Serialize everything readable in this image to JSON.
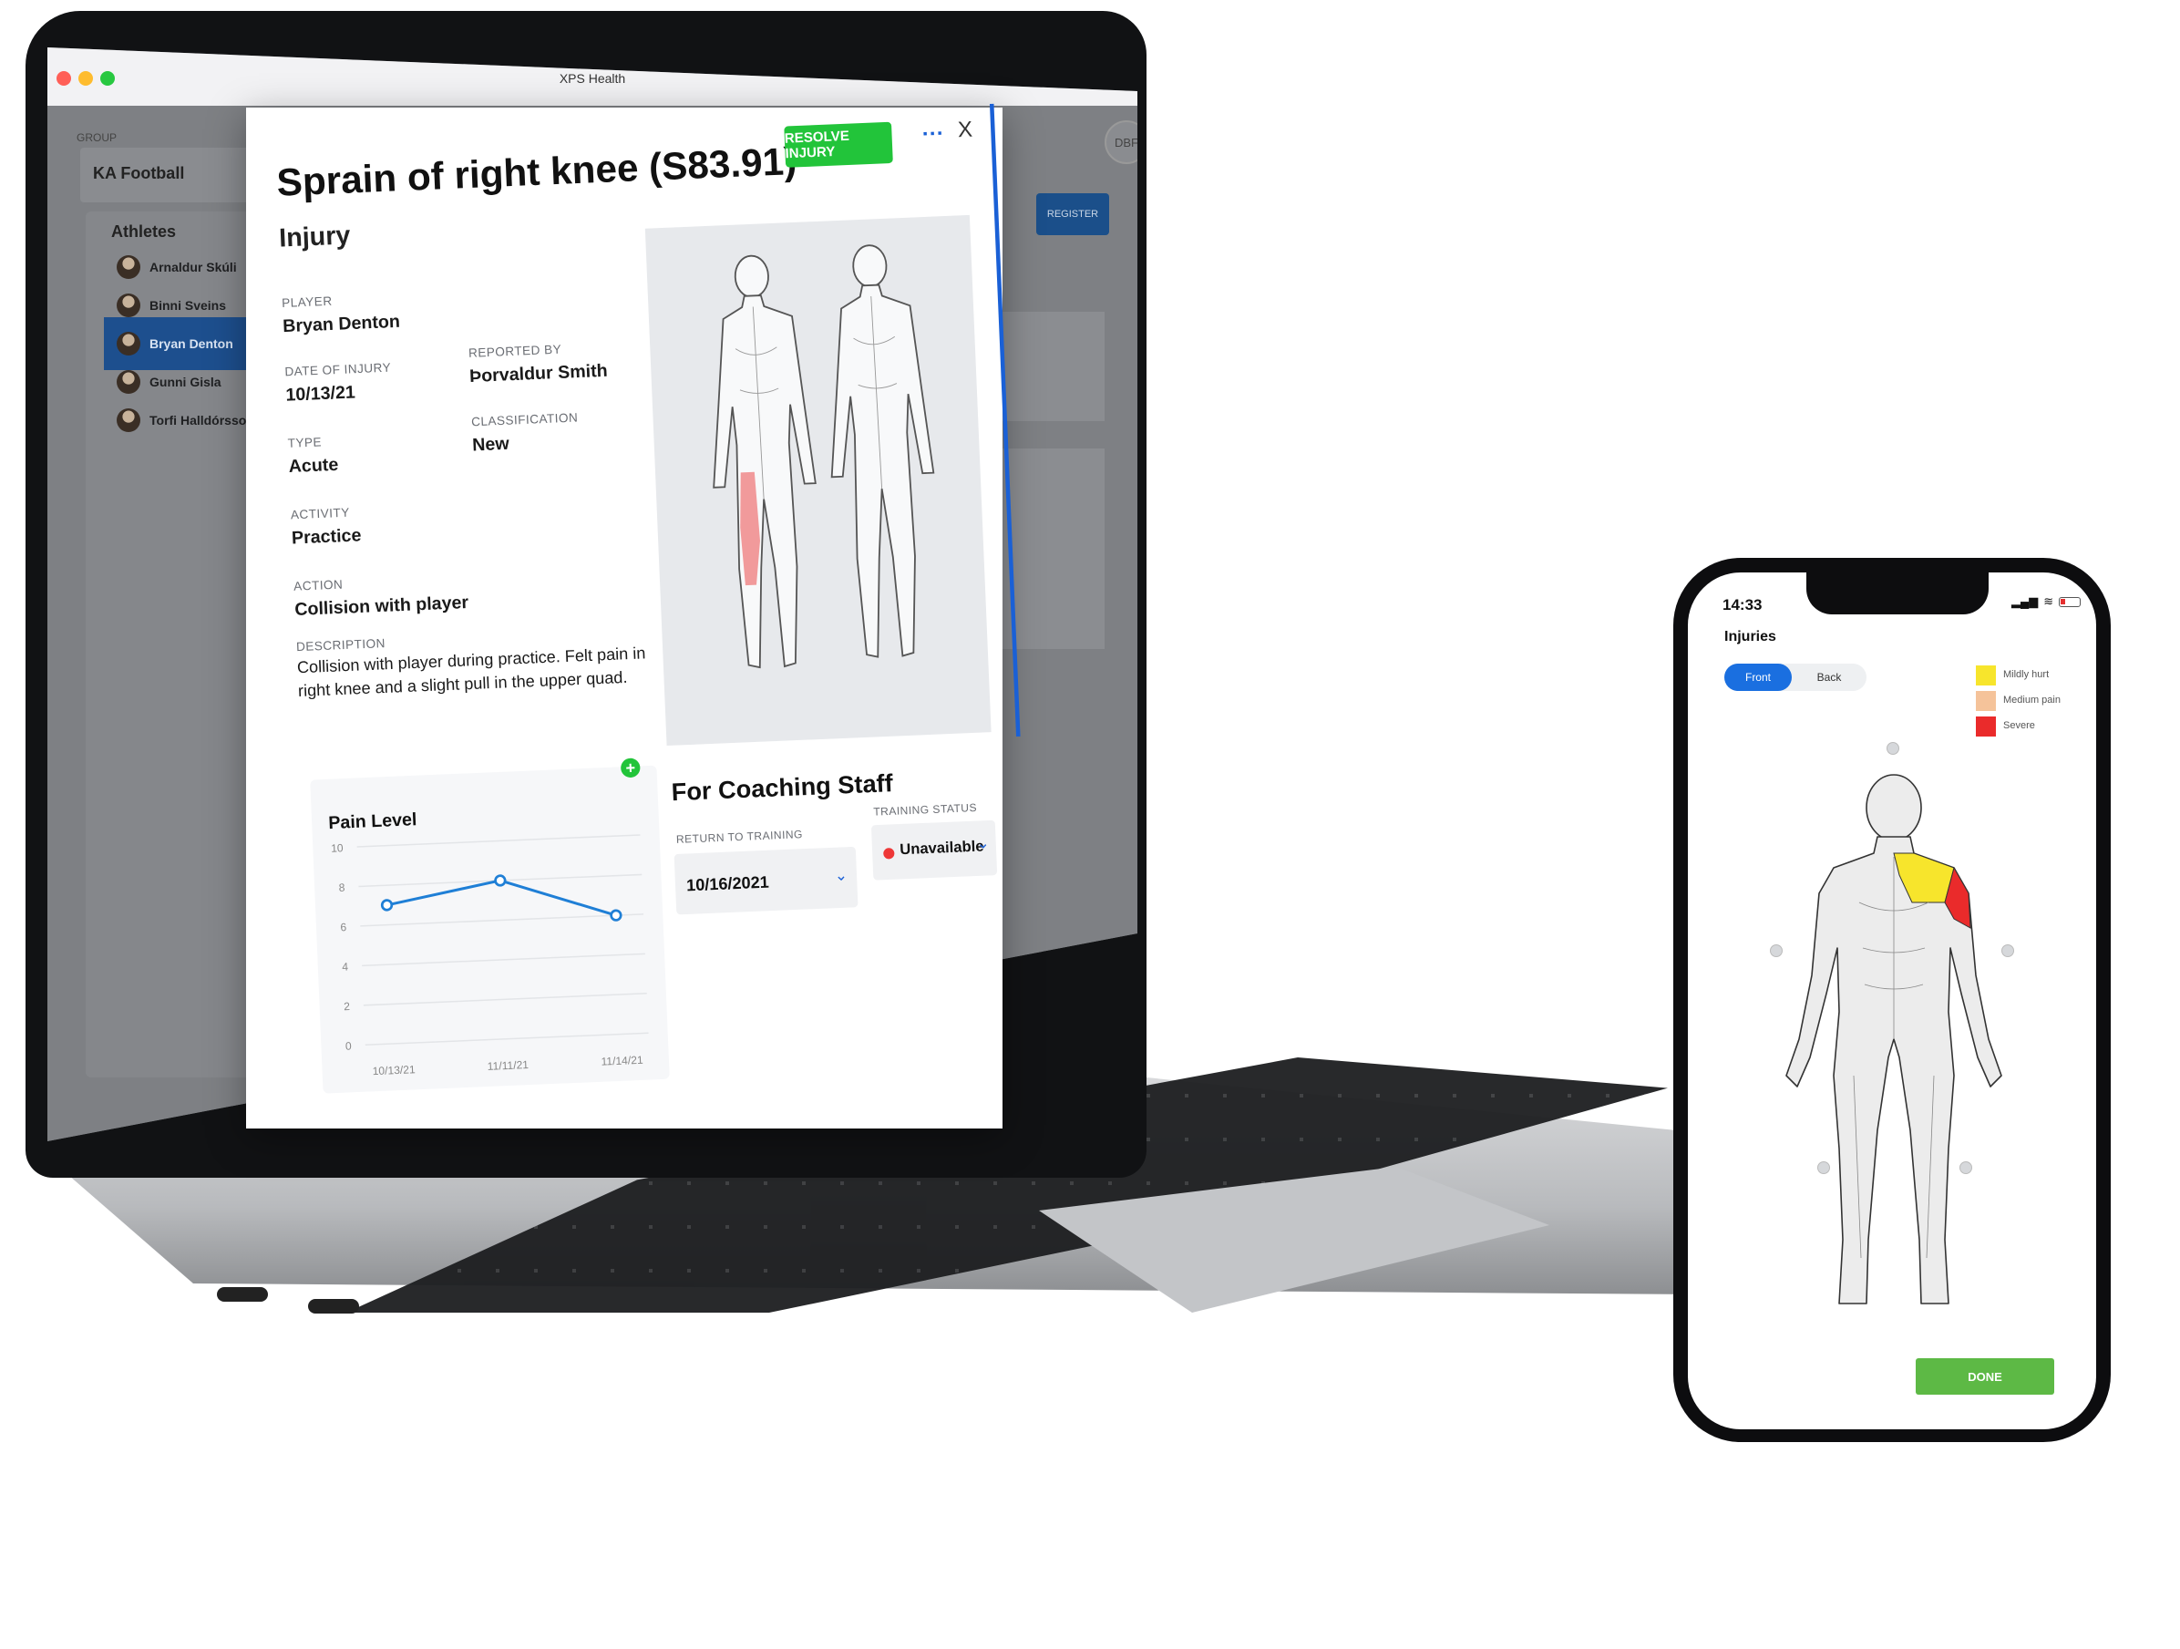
{
  "window": {
    "title": "XPS Health"
  },
  "app": {
    "group_label": "GROUP",
    "group_value": "KA Football",
    "user_initials": "DBF",
    "register_label": "REGISTER",
    "athletes_title": "Athletes",
    "athletes": [
      {
        "name": "Arnaldur Skúli",
        "active": false
      },
      {
        "name": "Binni Sveins",
        "active": false
      },
      {
        "name": "Bryan Denton",
        "active": true
      },
      {
        "name": "Gunni Gisla",
        "active": false
      },
      {
        "name": "Torfi Halldórsson",
        "active": false
      }
    ],
    "bg_partial_texts": [
      "able",
      "tus",
      "sson",
      "sson"
    ]
  },
  "injury_modal": {
    "title": "Sprain of right knee  (S83.91)",
    "subtitle": "Injury",
    "resolve_label": "RESOLVE INJURY",
    "more_label": "···",
    "close_label": "X",
    "fields": {
      "player_label": "PLAYER",
      "player_value": "Bryan Denton",
      "date_label": "DATE OF INJURY",
      "date_value": "10/13/21",
      "reported_label": "REPORTED BY",
      "reported_value": "Þorvaldur Smith",
      "type_label": "TYPE",
      "type_value": "Acute",
      "classification_label": "CLASSIFICATION",
      "classification_value": "New",
      "activity_label": "ACTIVITY",
      "activity_value": "Practice",
      "action_label": "ACTION",
      "action_value": "Collision with player",
      "description_label": "DESCRIPTION",
      "description_value": "Collision with player during practice. Felt pain in right knee and a slight pull in the upper quad."
    },
    "coaching": {
      "title": "For Coaching Staff",
      "return_label": "RETURN TO TRAINING",
      "return_value": "10/16/2021",
      "status_label": "TRAINING STATUS",
      "status_value": "Unavailable",
      "status_color": "#ee3737"
    },
    "body_highlight_color": "#f08a8a"
  },
  "pain_chart_title": "Pain Level",
  "chart_data": {
    "type": "line",
    "title": "Pain Level",
    "categories": [
      "10/13/21",
      "11/11/21",
      "11/14/21"
    ],
    "series": [
      {
        "values": [
          7,
          8,
          6
        ]
      }
    ],
    "yticks": [
      0,
      2,
      4,
      6,
      8,
      10
    ],
    "ylim": [
      0,
      10
    ],
    "color": "#1f7fd6",
    "grid": true
  },
  "phone": {
    "time": "14:33",
    "title": "Injuries",
    "tab_front": "Front",
    "tab_back": "Back",
    "legend": [
      {
        "label": "Mildly hurt",
        "color": "#f7e52c"
      },
      {
        "label": "Medium pain",
        "color": "#f5c39a"
      },
      {
        "label": "Severe",
        "color": "#ea2b2b"
      }
    ],
    "done_label": "DONE"
  }
}
